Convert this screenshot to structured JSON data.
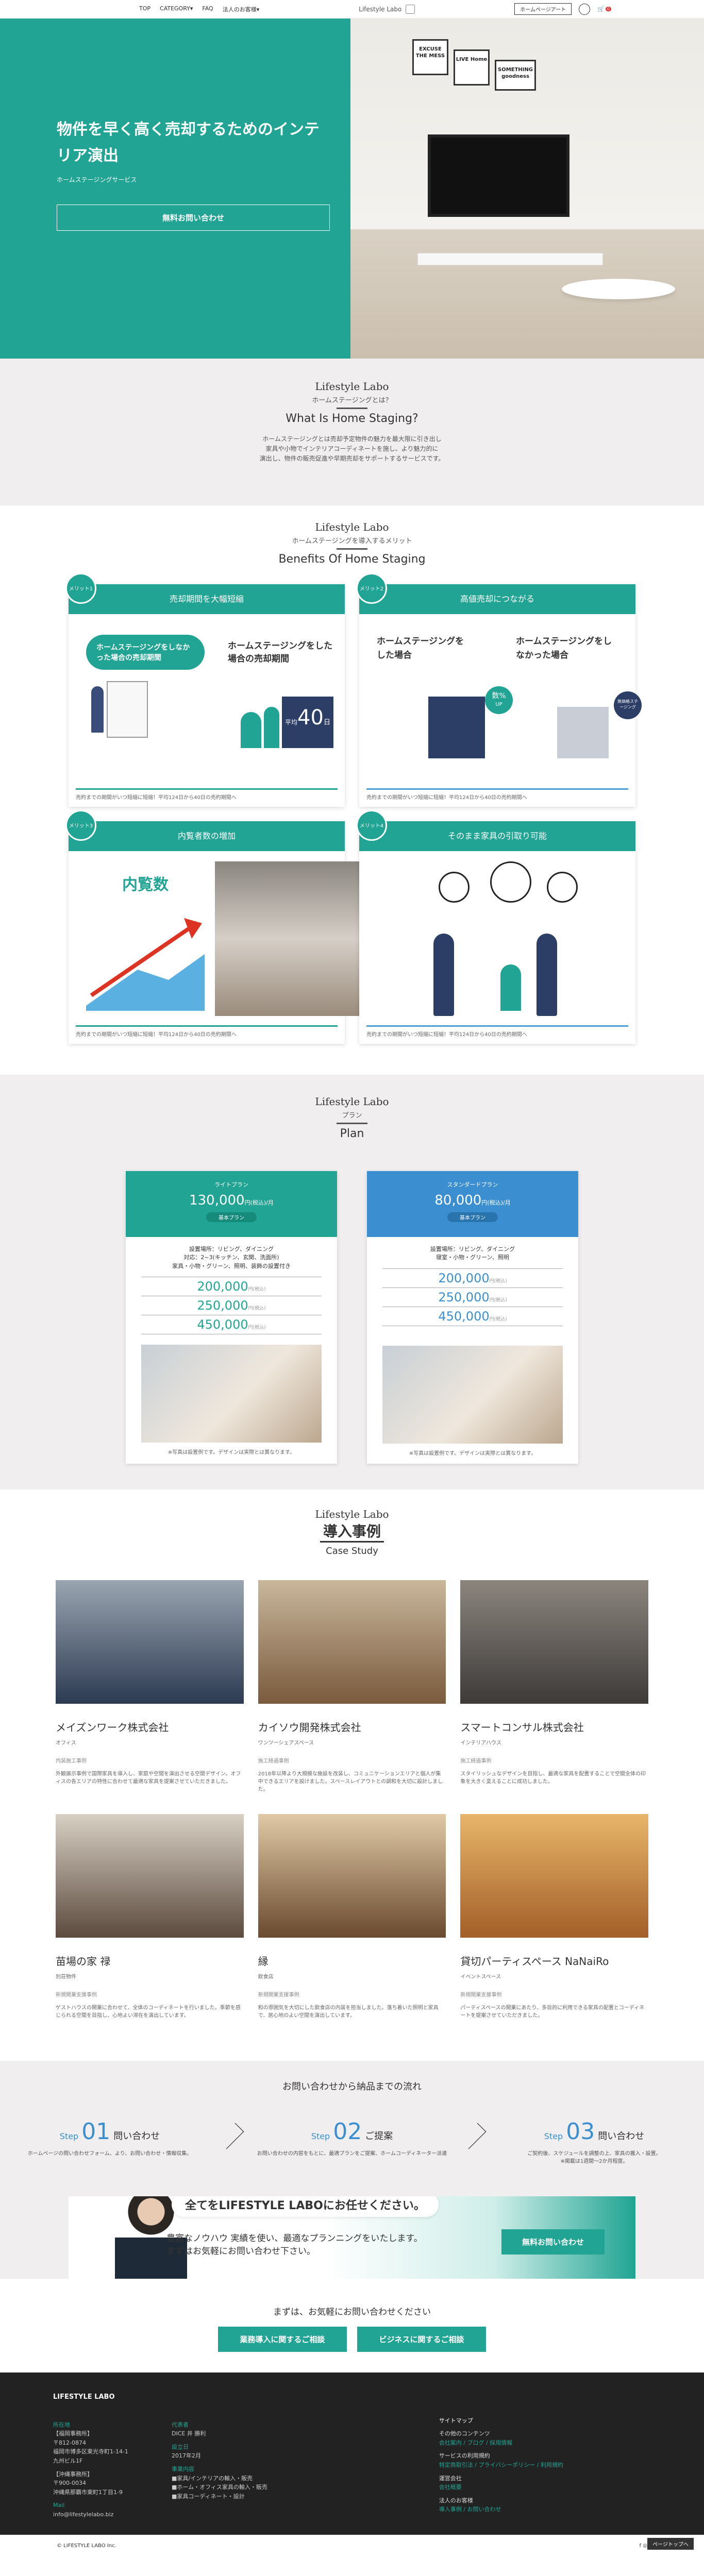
{
  "header": {
    "nav": [
      "TOP",
      "CATEGORY▾",
      "FAQ",
      "法人のお客様▾"
    ],
    "logo": "Lifestyle Labo",
    "button": "ホームページアート",
    "cart_count": "0"
  },
  "hero": {
    "title": "物件を早く高く売却するためのインテリア演出",
    "subtitle": "ホームステージングサービス",
    "cta": "無料お問い合わせ",
    "frame1": "EXCUSE THE MESS",
    "frame2": "LIVE Home",
    "frame3": "SOMETHING goodness"
  },
  "about": {
    "t1": "Lifestyle Labo",
    "t2": "ホームステージングとは？",
    "t3": "What Is Home Staging?",
    "text": "ホームステージングとは売却予定物件の魅力を最大限に引き出し\n家具や小物でインテリアコーディネートを施し、より魅力的に\n演出し、物件の販売促進や早期売却をサポートするサービスです。"
  },
  "merits": {
    "t1": "Lifestyle Labo",
    "t2": "ホームステージングを導入するメリット",
    "t3": "Benefits Of Home Staging",
    "cards": [
      {
        "no": "メリット1",
        "title": "売却期間を大幅短縮",
        "l1": "ホームステージングをしなかった場合の売却期間",
        "l2": "ホームステージングをした場合の売却期間",
        "val": "40",
        "pre": "平均",
        "unit": "日",
        "note": "売約までの期間がいつ短縮に短縮！平均124日から40日の売約期間へ"
      },
      {
        "no": "メリット2",
        "title": "高値売却につながる",
        "l1": "ホームステージングをした場合",
        "l2": "ホームステージングをしなかった場合",
        "val": "数%",
        "unit": "UP",
        "badge": "無価格ステージング",
        "note": "売約までの期間がいつ短縮に短縮！平均124日から40日の売約期間へ"
      },
      {
        "no": "メリット3",
        "title": "内覧者数の増加",
        "l1": "内覧数",
        "note": "売約までの期間がいつ短縮に短縮！平均124日から40日の売約期間へ"
      },
      {
        "no": "メリット4",
        "title": "そのまま家具の引取り可能",
        "note": "売約までの期間がいつ短縮に短縮！平均124日から40日の売約期間へ"
      }
    ]
  },
  "plan": {
    "t1": "Lifestyle Labo",
    "t2": "プラン",
    "t3": "Plan",
    "plans": [
      {
        "name": "ライトプラン",
        "price": "130,000",
        "unit": "円(税込)/月",
        "label": "基本プラン",
        "desc": "設置場所：リビング、ダイニング\n対応：2~3(キッチン、玄関、洗面所)\n家具・小物・グリーン、照明、装飾の設置付き",
        "rows": [
          [
            "200,000",
            "円(税込)"
          ],
          [
            "250,000",
            "円(税込)"
          ],
          [
            "450,000",
            "円(税込)"
          ]
        ],
        "cap": "※写真は設置例です。デザインは実際とは異なります。",
        "color": "#21a493"
      },
      {
        "name": "スタンダードプラン",
        "price": "80,000",
        "unit": "円(税込)/月",
        "label": "基本プラン",
        "desc": "設置場所：リビング、ダイニング\n寝室・小物・グリーン、照明",
        "rows": [
          [
            "200,000",
            "円(税込)"
          ],
          [
            "250,000",
            "円(税込)"
          ],
          [
            "450,000",
            "円(税込)"
          ]
        ],
        "cap": "※写真は設置例です。デザインは実際とは異なります。",
        "color": "#3b8fd0"
      }
    ]
  },
  "cases": {
    "t1": "Lifestyle Labo",
    "t2": "導入事例",
    "t3": "Case Study",
    "items": [
      {
        "name": "メイズンワーク株式会社",
        "tag": "オフィス",
        "sub": "内装施工事例",
        "desc": "外観展示事例で国際家具を導入し、家庭や空間を演出させる空間デザイン。オフィスの各エリアの特性に合わせて最適な家具を提案させていただきました。",
        "c1": "#2c3a52",
        "c2": "#9aa5b1"
      },
      {
        "name": "カイソウ開発株式会社",
        "tag": "ワンツーシェアスペース",
        "sub": "施工経過事例",
        "desc": "2018年以降より大規模な施設を改装し、コミュニケーションエリアと個人が集中できるエリアを設けました。スペースレイアウトとの調和を大切に設計しました。",
        "c1": "#7a5a3d",
        "c2": "#c9b79c"
      },
      {
        "name": "スマートコンサル株式会社",
        "tag": "インテリアハウス",
        "sub": "施工経過事例",
        "desc": "スタイリッシュなデザインを目指し、最適な家具を配置することで空間全体の印象を大きく変えることに成功しました。",
        "c1": "#3d3a38",
        "c2": "#8c857e"
      },
      {
        "name": "苗場の家 禄",
        "tag": "別荘物件",
        "sub": "新規開業支援事例",
        "desc": "ゲストハウスの開業に合わせて、全体のコーディネートを行いました。季節を感じられる空間を目指し、心地よい滞在を演出しています。",
        "c1": "#5c4a3e",
        "c2": "#d8d0c4"
      },
      {
        "name": "縁",
        "tag": "飲食店",
        "sub": "新規開業支援事例",
        "desc": "和の雰囲気を大切にした飲食店の内装を担当しました。落ち着いた照明と家具で、居心地のよい空間を演出しています。",
        "c1": "#6b4a2f",
        "c2": "#e0c9a6"
      },
      {
        "name": "貸切パーティスペース NaNaiRo",
        "tag": "イベントスペース",
        "sub": "新規開業支援事例",
        "desc": "パーティスペースの開業にあたり、多目的に利用できる家具の配置とコーディネートを提案させていただきました。",
        "c1": "#a35f28",
        "c2": "#e8b56a"
      }
    ]
  },
  "flow": {
    "title": "お問い合わせから納品までの流れ",
    "steps": [
      {
        "pre": "Step",
        "num": "01",
        "label": "問い合わせ",
        "text": "ホームページの問い合わせフォーム、より、お問い合わせ・情報収集。"
      },
      {
        "pre": "Step",
        "num": "02",
        "label": "ご提案",
        "text": "お問い合わせの内容をもとに、最適プランをご提案、ホームコーディネーター派遣"
      },
      {
        "pre": "Step",
        "num": "03",
        "label": "問い合わせ",
        "text": "ご契約後、スケジュールを調整の上、家具の搬入・設置。\n※掲載は1週間〜2か月程度。"
      }
    ]
  },
  "banner": {
    "h": "全てをLIFESTYLE LABOにお任せください。",
    "p": "豊富なノウハウ 実績を使い、最適なプランニングをいたします。\nまずはお気軽にお問い合わせ下さい。",
    "btn": "無料お問い合わせ"
  },
  "contact": {
    "title": "まずは、お気軽にお問い合わせください",
    "b1": "業務導入に関するご相談",
    "b2": "ビジネスに関するご相談"
  },
  "footer": {
    "logo": "LIFESTYLE LABO",
    "c1": [
      [
        "所在地",
        "【福岡事務所】\n〒812-0874\n福岡市博多区東光寺町1-14-1\n九州ビル1F"
      ],
      [
        "",
        "【沖縄事務所】\n〒900-0034\n沖縄県那覇市東町1丁目1-9"
      ],
      [
        "Mail",
        "info@lifestylelabo.biz"
      ]
    ],
    "c2": [
      [
        "代表者",
        "DICE 井 勝利"
      ],
      [
        "設立日",
        "2017年2月"
      ],
      [
        "事業内容",
        "■家具/インテリアの輸入・販売\n■ホーム・オフィス家具の輸入・販売\n■家具コーディネート・設計"
      ]
    ],
    "c3": [
      [
        "サイトマップ",
        ""
      ],
      [
        "その他のコンテンツ",
        "会社案内 / ブログ / 採用情報"
      ],
      [
        "サービスの利用規約",
        "特定商取引法 / プライバシーポリシー / 利用規約"
      ],
      [
        "運営会社",
        "会社概要"
      ],
      [
        "法人のお客様",
        "導入事例 / お問い合わせ"
      ]
    ],
    "copy": "© LIFESTYLE LABO Inc.",
    "top": "ページトップへ"
  }
}
